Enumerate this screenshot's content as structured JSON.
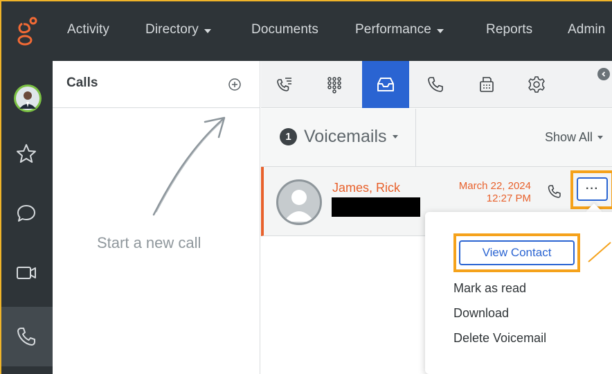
{
  "topnav": {
    "items": [
      {
        "label": "Activity",
        "dropdown": false
      },
      {
        "label": "Directory",
        "dropdown": true
      },
      {
        "label": "Documents",
        "dropdown": false
      },
      {
        "label": "Performance",
        "dropdown": true
      },
      {
        "label": "Reports",
        "dropdown": false
      },
      {
        "label": "Admin",
        "dropdown": false
      }
    ]
  },
  "calls": {
    "title": "Calls",
    "empty_text": "Start a new call"
  },
  "tabs": [
    {
      "icon": "call-log-icon"
    },
    {
      "icon": "dialpad-icon"
    },
    {
      "icon": "inbox-icon",
      "active": true
    },
    {
      "icon": "phone-icon"
    },
    {
      "icon": "fax-icon"
    },
    {
      "icon": "settings-icon"
    }
  ],
  "voicemails": {
    "count": "1",
    "label": "Voicemails",
    "filter": "Show All"
  },
  "voicemail_row": {
    "name": "James, Rick",
    "date": "March 22, 2024",
    "time": "12:27 PM",
    "more_label": "···"
  },
  "menu": {
    "view_contact": "View Contact",
    "mark_read": "Mark as read",
    "download": "Download",
    "delete": "Delete Voicemail"
  },
  "colors": {
    "accent": "#2a64d2",
    "highlight": "#f5a21b",
    "unread": "#e8612c",
    "nav_bg": "#2e3438"
  }
}
